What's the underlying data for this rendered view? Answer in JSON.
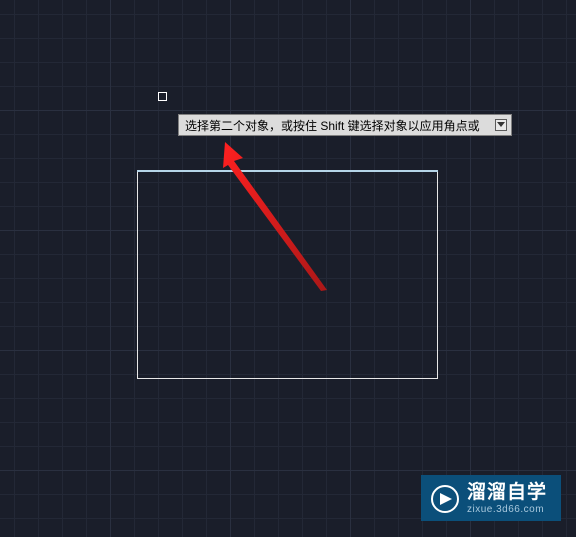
{
  "tooltip": {
    "text": "选择第二个对象，或按住 Shift 键选择对象以应用角点或"
  },
  "cursor": {
    "type": "pickbox"
  },
  "drawing": {
    "selected_object": "top-edge",
    "shape": "rectangle"
  },
  "watermark": {
    "brand": "溜溜自学",
    "url": "zixue.3d66.com"
  }
}
